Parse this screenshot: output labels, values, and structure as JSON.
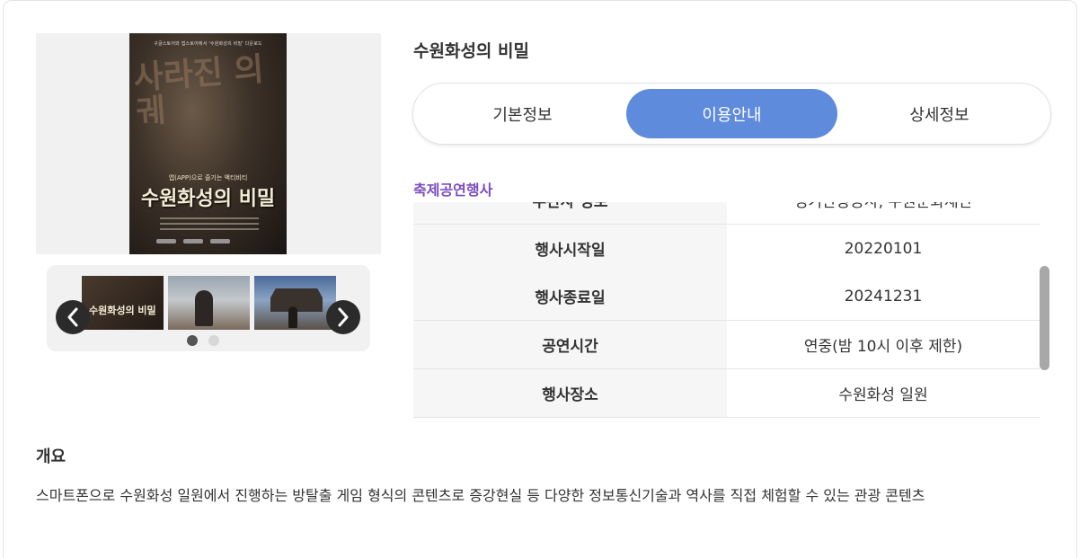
{
  "poster": {
    "top_line": "구글스토어와 앱스토어에서 '수원화성의 비밀' 다운로드",
    "watermark": "사라진 의궤",
    "subtitle": "앱(APP)으로 즐기는 액티비티",
    "title": "수원화성의 비밀"
  },
  "thumbnail_strip": {
    "thumb1_text": "수원화성의 비밀",
    "prev_icon": "chevron-left-icon",
    "next_icon": "chevron-right-icon",
    "active_dot": 1,
    "dot_count": 2
  },
  "event": {
    "title": "수원화성의 비밀"
  },
  "tabs": [
    {
      "label": "기본정보",
      "active": false
    },
    {
      "label": "이용안내",
      "active": true
    },
    {
      "label": "상세정보",
      "active": false
    }
  ],
  "category": "축제공연행사",
  "info_rows": [
    {
      "key": "주관사 정보",
      "value": "경기관광공사, 수원문화재단"
    },
    {
      "key": "행사시작일",
      "value": "20220101"
    },
    {
      "key": "행사종료일",
      "value": "20241231"
    },
    {
      "key": "공연시간",
      "value": "연중(밤 10시 이후 제한)"
    },
    {
      "key": "행사장소",
      "value": "수원화성 일원"
    }
  ],
  "overview": {
    "heading": "개요",
    "text": "스마트폰으로 수원화성 일원에서 진행하는 방탈출 게임 형식의 콘텐츠로 증강현실 등 다양한 정보통신기술과 역사를 직접 체험할 수 있는 관광 콘텐츠"
  },
  "colors": {
    "accent_tab": "#5f8bdd",
    "category": "#7a4dbf",
    "table_key_bg": "#f6f6f6"
  }
}
